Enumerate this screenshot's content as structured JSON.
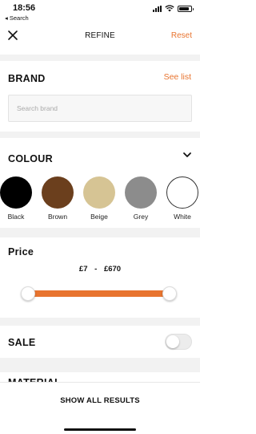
{
  "status_bar": {
    "time": "18:56",
    "back_label": "◂ Search"
  },
  "header": {
    "title": "REFINE",
    "reset_label": "Reset"
  },
  "brand": {
    "title": "BRAND",
    "see_list_label": "See list",
    "search_placeholder": "Search brand",
    "search_value": ""
  },
  "colour": {
    "title": "COLOUR",
    "swatches": [
      {
        "label": "Black",
        "color": "#000000"
      },
      {
        "label": "Brown",
        "color": "#6b3f1d"
      },
      {
        "label": "Beige",
        "color": "#d6c494"
      },
      {
        "label": "Grey",
        "color": "#8c8c8c"
      },
      {
        "label": "White",
        "color": "#ffffff"
      }
    ]
  },
  "price": {
    "title": "Price",
    "min": "£7",
    "separator": "-",
    "max": "£670"
  },
  "sale": {
    "title": "SALE",
    "enabled": false
  },
  "material": {
    "title": "MATERIAL"
  },
  "footer": {
    "show_all_label": "SHOW ALL RESULTS"
  },
  "colors": {
    "accent": "#e8742f",
    "section_gap": "#f2f2f2"
  }
}
